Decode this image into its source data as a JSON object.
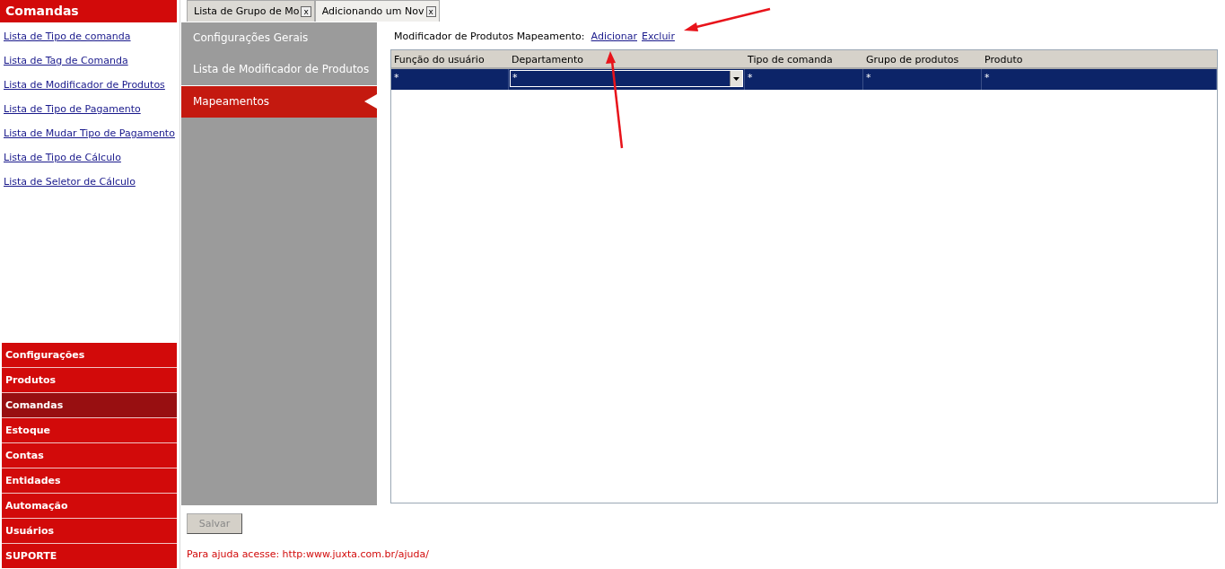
{
  "sidebar": {
    "title": "Comandas",
    "links": [
      "Lista de Tipo de comanda",
      "Lista de Tag de Comanda",
      "Lista de Modificador de Produtos",
      "Lista de Tipo de Pagamento",
      "Lista de Mudar Tipo de Pagamento",
      "Lista de Tipo de Cálculo",
      "Lista de Seletor de Cálculo"
    ],
    "nav": [
      {
        "label": "Configurações",
        "selected": false
      },
      {
        "label": "Produtos",
        "selected": false
      },
      {
        "label": "Comandas",
        "selected": true
      },
      {
        "label": "Estoque",
        "selected": false
      },
      {
        "label": "Contas",
        "selected": false
      },
      {
        "label": "Entidades",
        "selected": false
      },
      {
        "label": "Automação",
        "selected": false
      },
      {
        "label": "Usuários",
        "selected": false
      },
      {
        "label": "SUPORTE",
        "selected": false
      }
    ]
  },
  "tabs": [
    {
      "label": "Lista de Grupo de Mo",
      "close": "x",
      "selected": false
    },
    {
      "label": "Adicionando um Nov",
      "close": "x",
      "selected": true
    }
  ],
  "section_menu": [
    {
      "label": "Configurações Gerais",
      "selected": false
    },
    {
      "label": "Lista de Modificador de Produtos",
      "selected": false
    },
    {
      "label": "Mapeamentos",
      "selected": true
    }
  ],
  "mapping": {
    "label": "Modificador de Produtos Mapeamento:",
    "links": [
      "Adicionar",
      "Excluir"
    ],
    "table": {
      "columns": [
        "Função do usuário",
        "Departamento",
        "Tipo de comanda",
        "Grupo de produtos",
        "Produto"
      ],
      "rows": [
        {
          "selected": true,
          "cells": [
            {
              "kind": "text",
              "value": "*"
            },
            {
              "kind": "dropdown",
              "value": "*"
            },
            {
              "kind": "text",
              "value": "*"
            },
            {
              "kind": "text",
              "value": "*"
            },
            {
              "kind": "text",
              "value": "*"
            }
          ]
        }
      ]
    }
  },
  "save_button": {
    "label": "Salvar",
    "disabled": true
  },
  "help_text": "Para ajuda acesse: http:www.juxta.com.br/ajuda/"
}
